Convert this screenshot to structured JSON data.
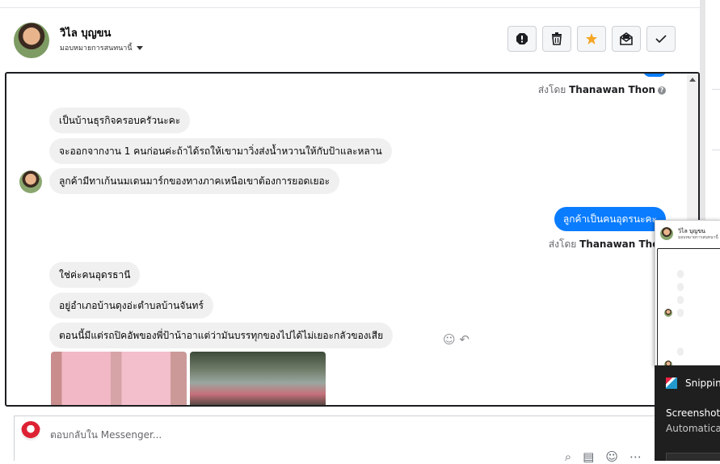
{
  "header": {
    "contact_name": "วิไล บุญขน",
    "assign_label": "มอบหมายการสนทนานี้",
    "actions": [
      "spam-alert",
      "delete",
      "star",
      "mark-unread",
      "done"
    ]
  },
  "conversation": {
    "sent_by_prefix": "ส่งโดย",
    "sent_by_name": "Thanawan Thon",
    "messages_group1": [
      "เป็นบ้านธุรกิจครอบครัวนะคะ",
      "จะออกจากงาน 1 คนก่อนค่ะถ้าได้รถให้เขามาวิ่งส่งน้ำหวานให้กับป้าและหลาน",
      "ลูกค้ามีทาเก้นนมเดนมาร์กของทางภาคเหนือเขาต้องการยอดเยอะ"
    ],
    "outgoing_message": "ลูกค้าเป็นคนอุดรนะคะ",
    "messages_group2": [
      "ใช่ค่ะคนอุดรธานี",
      "อยู่อำเภอบ้านดุงอ่ะตำบลบ้านจันทร์",
      "ตอนนี้มีแต่รถปิคอัพของพี่ป้าน้าอาแต่ว่ามันบรรทุกของไปได้ไม่เยอะกลัวของเสีย"
    ]
  },
  "composer": {
    "placeholder": "ตอบกลับใน Messenger..."
  },
  "snipping_toast": {
    "app": "Snipping Tool",
    "title": "Screenshot copied",
    "body": "Automatically saved"
  },
  "colors": {
    "outgoing_bubble": "#0a7cff",
    "incoming_bubble": "#f0f0f0",
    "star": "#f5a623"
  }
}
